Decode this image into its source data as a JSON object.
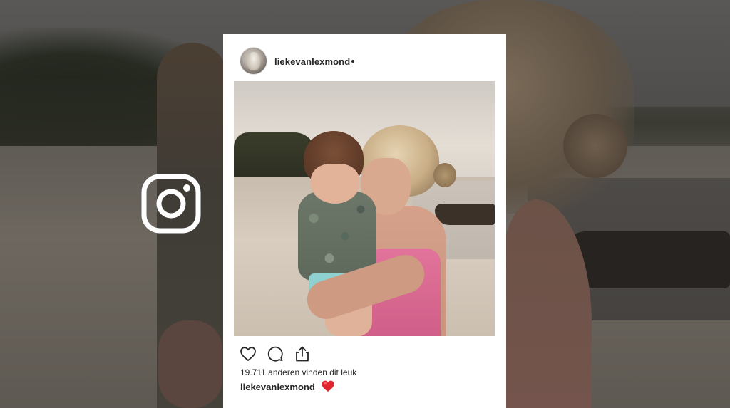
{
  "post": {
    "username": "liekevanlexmond",
    "likes_text": "19.711 anderen vinden dit leuk",
    "caption_user": "liekevanlexmond"
  },
  "icons": {
    "brand": "instagram-icon",
    "like": "heart-icon",
    "comment": "comment-icon",
    "share": "share-icon",
    "caption_emoji": "red-heart-icon"
  },
  "colors": {
    "card_bg": "#ffffff",
    "text": "#262626",
    "heart_red": "#e0252f"
  }
}
